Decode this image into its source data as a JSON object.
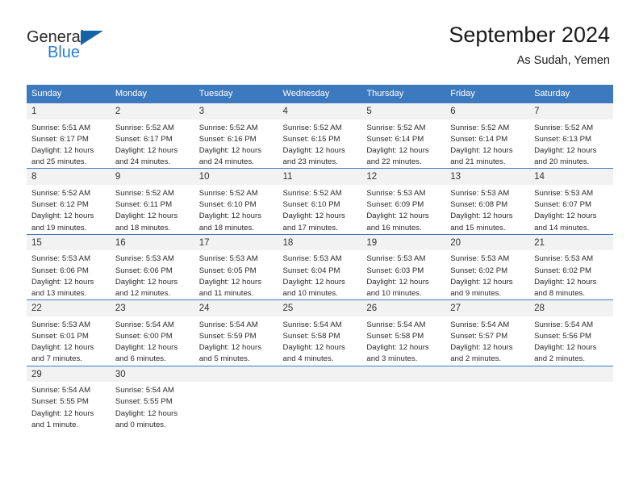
{
  "brand": {
    "name_part1": "General",
    "name_part2": "Blue"
  },
  "header": {
    "title": "September 2024",
    "location": "As Sudah, Yemen"
  },
  "calendar": {
    "weekday_headers": [
      "Sunday",
      "Monday",
      "Tuesday",
      "Wednesday",
      "Thursday",
      "Friday",
      "Saturday"
    ],
    "accent_color": "#3d79bf",
    "daynum_background": "#f2f2f2",
    "weeks": [
      [
        {
          "day": "1",
          "sunrise": "Sunrise: 5:51 AM",
          "sunset": "Sunset: 6:17 PM",
          "daylight_line1": "Daylight: 12 hours",
          "daylight_line2": "and 25 minutes."
        },
        {
          "day": "2",
          "sunrise": "Sunrise: 5:52 AM",
          "sunset": "Sunset: 6:17 PM",
          "daylight_line1": "Daylight: 12 hours",
          "daylight_line2": "and 24 minutes."
        },
        {
          "day": "3",
          "sunrise": "Sunrise: 5:52 AM",
          "sunset": "Sunset: 6:16 PM",
          "daylight_line1": "Daylight: 12 hours",
          "daylight_line2": "and 24 minutes."
        },
        {
          "day": "4",
          "sunrise": "Sunrise: 5:52 AM",
          "sunset": "Sunset: 6:15 PM",
          "daylight_line1": "Daylight: 12 hours",
          "daylight_line2": "and 23 minutes."
        },
        {
          "day": "5",
          "sunrise": "Sunrise: 5:52 AM",
          "sunset": "Sunset: 6:14 PM",
          "daylight_line1": "Daylight: 12 hours",
          "daylight_line2": "and 22 minutes."
        },
        {
          "day": "6",
          "sunrise": "Sunrise: 5:52 AM",
          "sunset": "Sunset: 6:14 PM",
          "daylight_line1": "Daylight: 12 hours",
          "daylight_line2": "and 21 minutes."
        },
        {
          "day": "7",
          "sunrise": "Sunrise: 5:52 AM",
          "sunset": "Sunset: 6:13 PM",
          "daylight_line1": "Daylight: 12 hours",
          "daylight_line2": "and 20 minutes."
        }
      ],
      [
        {
          "day": "8",
          "sunrise": "Sunrise: 5:52 AM",
          "sunset": "Sunset: 6:12 PM",
          "daylight_line1": "Daylight: 12 hours",
          "daylight_line2": "and 19 minutes."
        },
        {
          "day": "9",
          "sunrise": "Sunrise: 5:52 AM",
          "sunset": "Sunset: 6:11 PM",
          "daylight_line1": "Daylight: 12 hours",
          "daylight_line2": "and 18 minutes."
        },
        {
          "day": "10",
          "sunrise": "Sunrise: 5:52 AM",
          "sunset": "Sunset: 6:10 PM",
          "daylight_line1": "Daylight: 12 hours",
          "daylight_line2": "and 18 minutes."
        },
        {
          "day": "11",
          "sunrise": "Sunrise: 5:52 AM",
          "sunset": "Sunset: 6:10 PM",
          "daylight_line1": "Daylight: 12 hours",
          "daylight_line2": "and 17 minutes."
        },
        {
          "day": "12",
          "sunrise": "Sunrise: 5:53 AM",
          "sunset": "Sunset: 6:09 PM",
          "daylight_line1": "Daylight: 12 hours",
          "daylight_line2": "and 16 minutes."
        },
        {
          "day": "13",
          "sunrise": "Sunrise: 5:53 AM",
          "sunset": "Sunset: 6:08 PM",
          "daylight_line1": "Daylight: 12 hours",
          "daylight_line2": "and 15 minutes."
        },
        {
          "day": "14",
          "sunrise": "Sunrise: 5:53 AM",
          "sunset": "Sunset: 6:07 PM",
          "daylight_line1": "Daylight: 12 hours",
          "daylight_line2": "and 14 minutes."
        }
      ],
      [
        {
          "day": "15",
          "sunrise": "Sunrise: 5:53 AM",
          "sunset": "Sunset: 6:06 PM",
          "daylight_line1": "Daylight: 12 hours",
          "daylight_line2": "and 13 minutes."
        },
        {
          "day": "16",
          "sunrise": "Sunrise: 5:53 AM",
          "sunset": "Sunset: 6:06 PM",
          "daylight_line1": "Daylight: 12 hours",
          "daylight_line2": "and 12 minutes."
        },
        {
          "day": "17",
          "sunrise": "Sunrise: 5:53 AM",
          "sunset": "Sunset: 6:05 PM",
          "daylight_line1": "Daylight: 12 hours",
          "daylight_line2": "and 11 minutes."
        },
        {
          "day": "18",
          "sunrise": "Sunrise: 5:53 AM",
          "sunset": "Sunset: 6:04 PM",
          "daylight_line1": "Daylight: 12 hours",
          "daylight_line2": "and 10 minutes."
        },
        {
          "day": "19",
          "sunrise": "Sunrise: 5:53 AM",
          "sunset": "Sunset: 6:03 PM",
          "daylight_line1": "Daylight: 12 hours",
          "daylight_line2": "and 10 minutes."
        },
        {
          "day": "20",
          "sunrise": "Sunrise: 5:53 AM",
          "sunset": "Sunset: 6:02 PM",
          "daylight_line1": "Daylight: 12 hours",
          "daylight_line2": "and 9 minutes."
        },
        {
          "day": "21",
          "sunrise": "Sunrise: 5:53 AM",
          "sunset": "Sunset: 6:02 PM",
          "daylight_line1": "Daylight: 12 hours",
          "daylight_line2": "and 8 minutes."
        }
      ],
      [
        {
          "day": "22",
          "sunrise": "Sunrise: 5:53 AM",
          "sunset": "Sunset: 6:01 PM",
          "daylight_line1": "Daylight: 12 hours",
          "daylight_line2": "and 7 minutes."
        },
        {
          "day": "23",
          "sunrise": "Sunrise: 5:54 AM",
          "sunset": "Sunset: 6:00 PM",
          "daylight_line1": "Daylight: 12 hours",
          "daylight_line2": "and 6 minutes."
        },
        {
          "day": "24",
          "sunrise": "Sunrise: 5:54 AM",
          "sunset": "Sunset: 5:59 PM",
          "daylight_line1": "Daylight: 12 hours",
          "daylight_line2": "and 5 minutes."
        },
        {
          "day": "25",
          "sunrise": "Sunrise: 5:54 AM",
          "sunset": "Sunset: 5:58 PM",
          "daylight_line1": "Daylight: 12 hours",
          "daylight_line2": "and 4 minutes."
        },
        {
          "day": "26",
          "sunrise": "Sunrise: 5:54 AM",
          "sunset": "Sunset: 5:58 PM",
          "daylight_line1": "Daylight: 12 hours",
          "daylight_line2": "and 3 minutes."
        },
        {
          "day": "27",
          "sunrise": "Sunrise: 5:54 AM",
          "sunset": "Sunset: 5:57 PM",
          "daylight_line1": "Daylight: 12 hours",
          "daylight_line2": "and 2 minutes."
        },
        {
          "day": "28",
          "sunrise": "Sunrise: 5:54 AM",
          "sunset": "Sunset: 5:56 PM",
          "daylight_line1": "Daylight: 12 hours",
          "daylight_line2": "and 2 minutes."
        }
      ],
      [
        {
          "day": "29",
          "sunrise": "Sunrise: 5:54 AM",
          "sunset": "Sunset: 5:55 PM",
          "daylight_line1": "Daylight: 12 hours",
          "daylight_line2": "and 1 minute."
        },
        {
          "day": "30",
          "sunrise": "Sunrise: 5:54 AM",
          "sunset": "Sunset: 5:55 PM",
          "daylight_line1": "Daylight: 12 hours",
          "daylight_line2": "and 0 minutes."
        },
        {
          "day": "",
          "sunrise": "",
          "sunset": "",
          "daylight_line1": "",
          "daylight_line2": ""
        },
        {
          "day": "",
          "sunrise": "",
          "sunset": "",
          "daylight_line1": "",
          "daylight_line2": ""
        },
        {
          "day": "",
          "sunrise": "",
          "sunset": "",
          "daylight_line1": "",
          "daylight_line2": ""
        },
        {
          "day": "",
          "sunrise": "",
          "sunset": "",
          "daylight_line1": "",
          "daylight_line2": ""
        },
        {
          "day": "",
          "sunrise": "",
          "sunset": "",
          "daylight_line1": "",
          "daylight_line2": ""
        }
      ]
    ]
  }
}
